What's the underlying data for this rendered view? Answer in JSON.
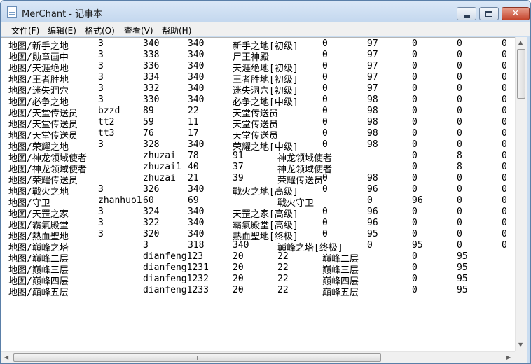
{
  "window": {
    "title": "MerChant - 记事本"
  },
  "menu": [
    "文件(F)",
    "编辑(E)",
    "格式(O)",
    "查看(V)",
    "帮助(H)"
  ],
  "rows": [
    [
      "地图/新手之地",
      "3",
      "340",
      "340",
      "新手之地[初级]",
      "0",
      "97",
      "0",
      "0",
      "0"
    ],
    [
      "地图/勋章画中",
      "3",
      "338",
      "340",
      "尸王神殿",
      "0",
      "97",
      "0",
      "0",
      "0"
    ],
    [
      "地图/天涯绝地",
      "3",
      "336",
      "340",
      "天涯绝地[初级]",
      "0",
      "97",
      "0",
      "0",
      "0"
    ],
    [
      "地图/王者胜地",
      "3",
      "334",
      "340",
      "王者胜地[初级]",
      "0",
      "97",
      "0",
      "0",
      "0"
    ],
    [
      "地图/迷失洞穴",
      "3",
      "332",
      "340",
      "迷失洞穴[初级]",
      "0",
      "97",
      "0",
      "0",
      "0"
    ],
    [
      "地图/必争之地",
      "3",
      "330",
      "340",
      "必争之地[中级]",
      "0",
      "98",
      "0",
      "0",
      "0"
    ],
    [
      "地图/天堂传送员",
      "bzzd",
      "89",
      "22",
      "天堂传送员",
      "0",
      "98",
      "0",
      "0",
      "0"
    ],
    [
      "地图/天堂传送员",
      "tt2",
      "59",
      "11",
      "天堂传送员",
      "0",
      "98",
      "0",
      "0",
      "0"
    ],
    [
      "地图/天堂传送员",
      "tt3",
      "76",
      "17",
      "天堂传送员",
      "0",
      "98",
      "0",
      "0",
      "0"
    ],
    [
      "地图/荣耀之地",
      "3",
      "328",
      "340",
      "荣耀之地[中级]",
      "0",
      "98",
      "0",
      "0",
      "0"
    ],
    [
      "地图/神龙领域使者",
      "zhuzai",
      "78",
      "91",
      "神龙领域使者",
      "0",
      "8",
      "0",
      "0"
    ],
    [
      "地图/神龙领域使者",
      "zhuzai1",
      "40",
      "37",
      "神龙领域使者",
      "0",
      "8",
      "0",
      "0"
    ],
    [
      "地图/荣耀传送员",
      "zhuzai",
      "21",
      "39",
      "荣耀传送员",
      "0",
      "98",
      "0",
      "0",
      "0"
    ],
    [
      "地图/戰火之地",
      "3",
      "326",
      "340",
      "戰火之地[高级]",
      "0",
      "96",
      "0",
      "0",
      "0"
    ],
    [
      "地图/守卫",
      "zhanhuo1",
      "60",
      "69",
      "戰火守卫",
      "0",
      "96",
      "0",
      "0"
    ],
    [
      "地图/天罡之家",
      "3",
      "324",
      "340",
      "天罡之家[高级]",
      "0",
      "96",
      "0",
      "0",
      "0"
    ],
    [
      "地图/霸氣殿堂",
      "3",
      "322",
      "340",
      "霸氣殿堂[高级]",
      "0",
      "96",
      "0",
      "0",
      "0"
    ],
    [
      "地图/熱血聖地",
      "3",
      "320",
      "340",
      "熱血聖地[终极]",
      "0",
      "95",
      "0",
      "0",
      "0"
    ],
    [
      "地图/巔峰之塔",
      "3",
      "318",
      "340",
      "巔峰之塔[终极]",
      "0",
      "95",
      "0",
      "0"
    ],
    [
      "地图/巔峰二层",
      "dianfeng123",
      "20",
      "22",
      "巔峰二层",
      "0",
      "95"
    ],
    [
      "地图/巔峰三层",
      "dianfeng1231",
      "20",
      "22",
      "巔峰三层",
      "0",
      "95"
    ],
    [
      "地图/巔峰四层",
      "dianfeng1232",
      "20",
      "22",
      "巔峰四层",
      "0",
      "95"
    ],
    [
      "地图/巔峰五层",
      "dianfeng1233",
      "20",
      "22",
      "巔峰五层",
      "0",
      "95"
    ]
  ]
}
